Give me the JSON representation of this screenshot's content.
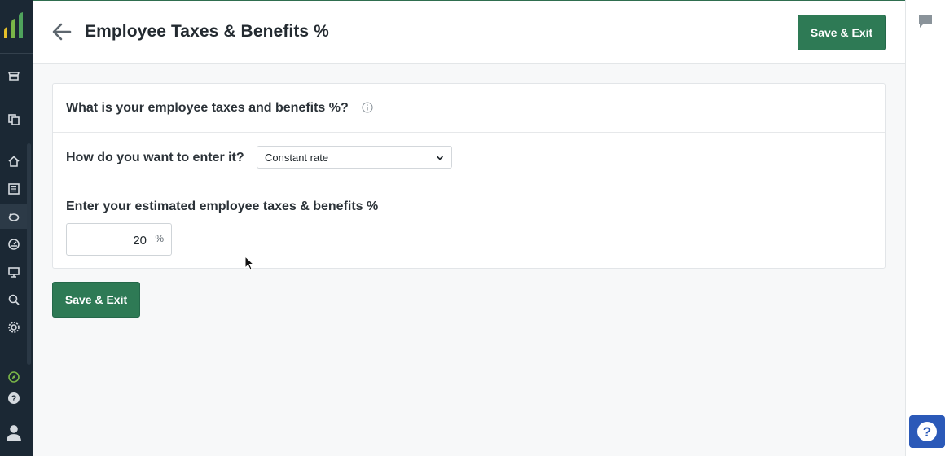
{
  "header": {
    "title": "Employee Taxes & Benefits %",
    "save_label": "Save & Exit"
  },
  "form": {
    "q1": "What is your employee taxes and benefits %?",
    "q2": "How do you want to enter it?",
    "entry_method": "Constant rate",
    "q3": "Enter your estimated employee taxes & benefits %",
    "percent_value": "20",
    "percent_unit": "%"
  },
  "footer": {
    "save_label": "Save & Exit"
  },
  "icons": {
    "nav": [
      "store-icon",
      "copy-icon",
      "home-icon",
      "list-icon",
      "piggy-bank-icon",
      "speedometer-icon",
      "monitor-icon",
      "magnify-icon",
      "gear-icon",
      "compass-icon",
      "help-icon",
      "user-icon"
    ],
    "header": [
      "back-arrow-icon"
    ],
    "rail": [
      "chat-icon",
      "help-icon"
    ]
  },
  "colors": {
    "primary": "#2e7a55",
    "nav_bg": "#1b2834",
    "help_blue": "#2b59b8"
  }
}
